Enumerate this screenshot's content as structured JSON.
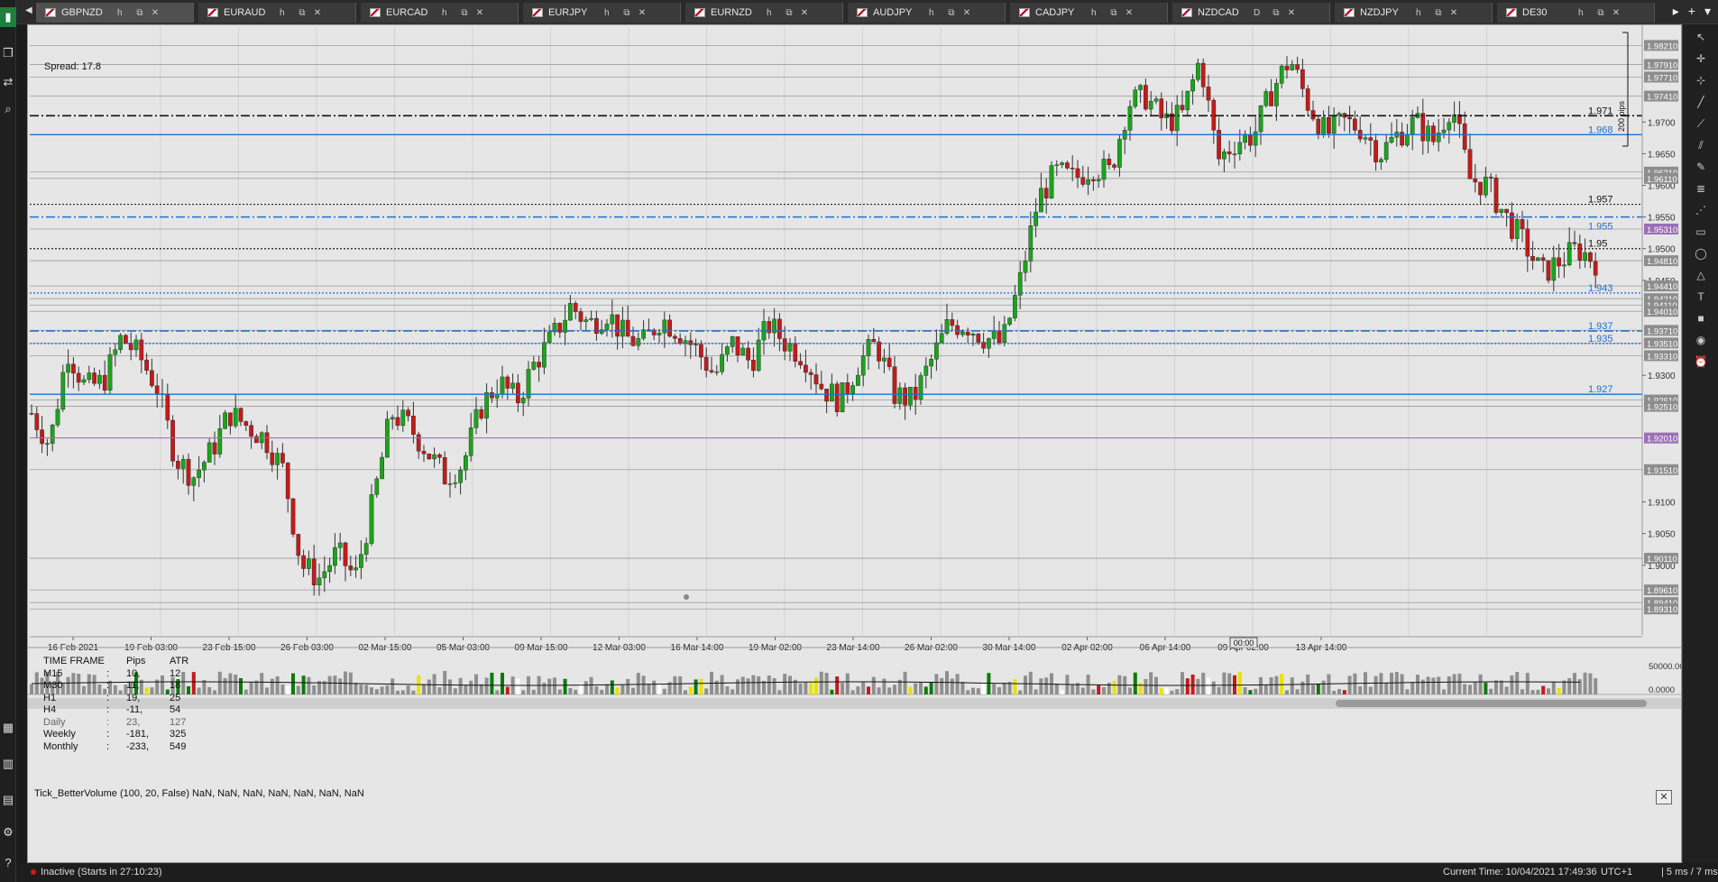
{
  "tabs": [
    {
      "symbol": "GBPNZD",
      "tf": "h",
      "active": true
    },
    {
      "symbol": "EURAUD",
      "tf": "h"
    },
    {
      "symbol": "EURCAD",
      "tf": "h"
    },
    {
      "symbol": "EURJPY",
      "tf": "h"
    },
    {
      "symbol": "EURNZD",
      "tf": "h"
    },
    {
      "symbol": "AUDJPY",
      "tf": "h"
    },
    {
      "symbol": "CADJPY",
      "tf": "h"
    },
    {
      "symbol": "NZDCAD",
      "tf": "D"
    },
    {
      "symbol": "NZDJPY",
      "tf": "h"
    },
    {
      "symbol": "DE30",
      "tf": "h"
    }
  ],
  "spread": "Spread:  17.8",
  "ruler_label": "200 pips",
  "timeframe_table": {
    "headers": [
      "TIME FRAME",
      "Pips",
      "ATR"
    ],
    "rows": [
      {
        "tf": "M15",
        "pips": "10,",
        "atr": "12"
      },
      {
        "tf": "M30",
        "pips": "11,",
        "atr": "18"
      },
      {
        "tf": "H1",
        "pips": "19,",
        "atr": "25"
      },
      {
        "tf": "H4",
        "pips": "-11,",
        "atr": "54"
      },
      {
        "tf": "Daily",
        "pips": "23,",
        "atr": "127"
      },
      {
        "tf": "Weekly",
        "pips": "-181,",
        "atr": "325"
      },
      {
        "tf": "Monthly",
        "pips": "-233,",
        "atr": "549"
      }
    ]
  },
  "volume_indicator_title": "Tick_BetterVolume (100, 20, False) NaN, NaN, NaN, NaN, NaN, NaN, NaN",
  "status": {
    "state": "Inactive (Starts in 27:10:23)",
    "current_time": "Current Time:  10/04/2021 17:49:36",
    "timezone": "UTC+1",
    "latency": "|  5 ms / 7 ms"
  },
  "colors": {
    "bull": "#1aa51a",
    "bear": "#c41a1a",
    "blue_level": "#1f6fd0",
    "purple_level": "#9b6fb5"
  },
  "chart_data": {
    "type": "candlestick",
    "symbol": "GBPNZD",
    "timeframe": "H4",
    "ylim": [
      1.889,
      1.985
    ],
    "y_ticks": [
      "1.9700",
      "1.9650",
      "1.9600",
      "1.9550",
      "1.9500",
      "1.9450",
      "1.9300",
      "1.9100",
      "1.9050",
      "1.9000"
    ],
    "x_ticks": [
      "16 Feb 2021",
      "19 Feb 03:00",
      "23 Feb 15:00",
      "26 Feb 03:00",
      "02 Mar 15:00",
      "05 Mar 03:00",
      "09 Mar 15:00",
      "12 Mar 03:00",
      "16 Mar 14:00",
      "19 Mar 02:00",
      "23 Mar 14:00",
      "26 Mar 02:00",
      "30 Mar 14:00",
      "02 Apr 02:00",
      "06 Apr 14:00",
      "09 Apr 02:00",
      "13 Apr 14:00"
    ],
    "cursor_time": "00:00",
    "levels": [
      {
        "price": 1.971,
        "style": "dashdot-black",
        "label": "1.971"
      },
      {
        "price": 1.968,
        "style": "solid-blue",
        "label": "1.968"
      },
      {
        "price": 1.957,
        "style": "dotted-black",
        "label": "1.957"
      },
      {
        "price": 1.955,
        "style": "dashdot-blue",
        "label": "1.955"
      },
      {
        "price": 1.95,
        "style": "dotted-black",
        "label": "1.95"
      },
      {
        "price": 1.943,
        "style": "dotted-blue",
        "label": "1.943"
      },
      {
        "price": 1.937,
        "style": "dashdot-blue",
        "label": "1.937"
      },
      {
        "price": 1.935,
        "style": "dotted-blue",
        "label": "1.935"
      },
      {
        "price": 1.927,
        "style": "solid-blue",
        "label": "1.927"
      },
      {
        "price": 1.9201,
        "style": "solid-purple",
        "label": ""
      }
    ],
    "price_tags": [
      {
        "price": 1.9821,
        "label": "1.98210"
      },
      {
        "price": 1.9791,
        "label": "1.97910"
      },
      {
        "price": 1.9771,
        "label": "1.97710"
      },
      {
        "price": 1.9741,
        "label": "1.97410"
      },
      {
        "price": 1.9621,
        "label": "1.96210"
      },
      {
        "price": 1.9611,
        "label": "1.96110"
      },
      {
        "price": 1.9531,
        "label": "1.95310",
        "highlight": true
      },
      {
        "price": 1.9481,
        "label": "1.94810"
      },
      {
        "price": 1.9441,
        "label": "1.94410"
      },
      {
        "price": 1.9421,
        "label": "1.94210"
      },
      {
        "price": 1.9411,
        "label": "1.94110"
      },
      {
        "price": 1.9401,
        "label": "1.94010"
      },
      {
        "price": 1.9371,
        "label": "1.93710"
      },
      {
        "price": 1.9351,
        "label": "1.93510"
      },
      {
        "price": 1.9331,
        "label": "1.93310"
      },
      {
        "price": 1.9261,
        "label": "1.92610"
      },
      {
        "price": 1.9251,
        "label": "1.92510"
      },
      {
        "price": 1.9201,
        "label": "1.92010",
        "purple": true
      },
      {
        "price": 1.9151,
        "label": "1.91510"
      },
      {
        "price": 1.9011,
        "label": "1.90110"
      },
      {
        "price": 1.8961,
        "label": "1.89610"
      },
      {
        "price": 1.8941,
        "label": "1.89410"
      },
      {
        "price": 1.8931,
        "label": "1.89310"
      }
    ],
    "close_path": [
      1.924,
      1.919,
      1.934,
      1.928,
      1.929,
      1.936,
      1.933,
      1.928,
      1.917,
      1.914,
      1.918,
      1.924,
      1.922,
      1.92,
      1.915,
      1.9,
      1.898,
      1.902,
      1.898,
      1.91,
      1.924,
      1.922,
      1.918,
      1.914,
      1.916,
      1.925,
      1.929,
      1.926,
      1.932,
      1.936,
      1.941,
      1.938,
      1.94,
      1.936,
      1.935,
      1.939,
      1.937,
      1.934,
      1.93,
      1.935,
      1.932,
      1.938,
      1.935,
      1.933,
      1.928,
      1.926,
      1.932,
      1.935,
      1.927,
      1.926,
      1.932,
      1.938,
      1.938,
      1.936,
      1.935,
      1.945,
      1.958,
      1.962,
      1.961,
      1.963,
      1.962,
      1.973,
      1.974,
      1.97,
      1.971,
      1.98,
      1.964,
      1.967,
      1.968,
      1.975,
      1.98,
      1.973,
      1.968,
      1.97,
      1.969,
      1.965,
      1.968,
      1.97,
      1.967,
      1.973,
      1.961,
      1.96,
      1.955,
      1.951,
      1.946,
      1.948,
      1.95,
      1.948
    ]
  }
}
